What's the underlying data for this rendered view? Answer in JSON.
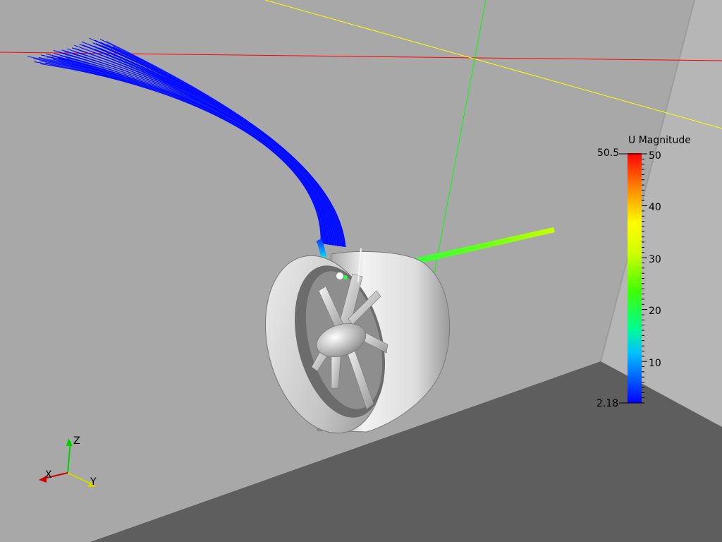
{
  "colorbar": {
    "title": "U Magnitude",
    "max_label": "50.5",
    "min_label": "2.18",
    "ticks": [
      "50",
      "40",
      "30",
      "20",
      "10"
    ],
    "colors": [
      "#0000ff",
      "#0080ff",
      "#00e0ff",
      "#00ff80",
      "#40ff00",
      "#c0ff00",
      "#ffff00",
      "#ffc000",
      "#ff8000",
      "#ff3000",
      "#ff0000"
    ]
  },
  "orientation_axes": {
    "x_label": "X",
    "y_label": "Y",
    "z_label": "Z"
  },
  "colors": {
    "background": "#a8a8a8",
    "floor": "#5e5e5e",
    "right_wall": "#b4b4b4",
    "x_axis_line": "#ff0000",
    "y_axis_line": "#ffff00",
    "z_axis_line": "#00ff00",
    "geometry": "#e6e6e6"
  }
}
